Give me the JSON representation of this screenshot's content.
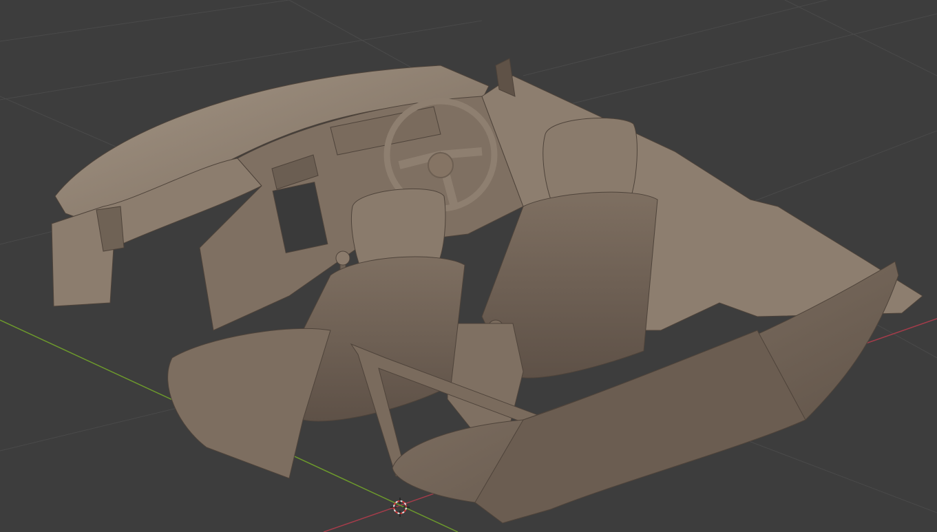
{
  "app": {
    "view": "3D Viewport",
    "shading": "solid"
  },
  "viewport": {
    "background_color": "#3d3d3d",
    "grid_color": "#4a4a4a",
    "x_axis_color": "#a53c4a",
    "y_axis_color": "#6d9a2c",
    "model_base_color": "#857464",
    "model_shadow_color": "#5f5247",
    "model_highlight_color": "#a99a8c"
  },
  "scene": {
    "object": "car-interior-mesh",
    "parts": [
      "dashboard",
      "steering-wheel",
      "gear-shifter",
      "center-display",
      "air-vents",
      "front-left-seat",
      "front-right-seat",
      "center-console",
      "rear-bench-seat",
      "seat-belt",
      "door-panel-right"
    ],
    "cursor_icon": "3d-cursor-icon"
  }
}
